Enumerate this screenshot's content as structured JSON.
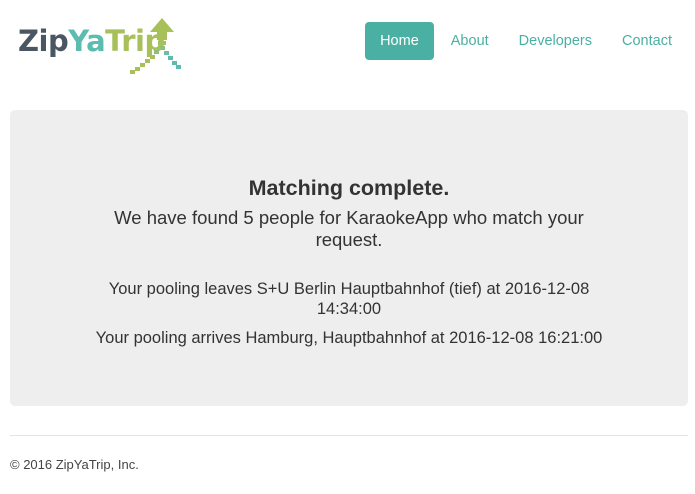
{
  "brand": {
    "part1": "Zip",
    "part2": "Ya",
    "part3": "Trip",
    "colors": {
      "zip": "#4a5763",
      "ya": "#5bbcb0",
      "trip": "#a8c05a"
    }
  },
  "nav": {
    "items": [
      {
        "label": "Home",
        "active": true
      },
      {
        "label": "About",
        "active": false
      },
      {
        "label": "Developers",
        "active": false
      },
      {
        "label": "Contact",
        "active": false
      }
    ],
    "accent": "#4ab0a3"
  },
  "result": {
    "title": "Matching complete.",
    "lead": "We have found 5 people for KaraokeApp who match your request.",
    "departure": "Your pooling leaves S+U Berlin Hauptbahnhof (tief) at 2016-12-08 14:34:00",
    "arrival": "Your pooling arrives Hamburg, Hauptbahnhof at 2016-12-08 16:21:00"
  },
  "footer": {
    "copyright": "© 2016 ZipYaTrip, Inc."
  }
}
